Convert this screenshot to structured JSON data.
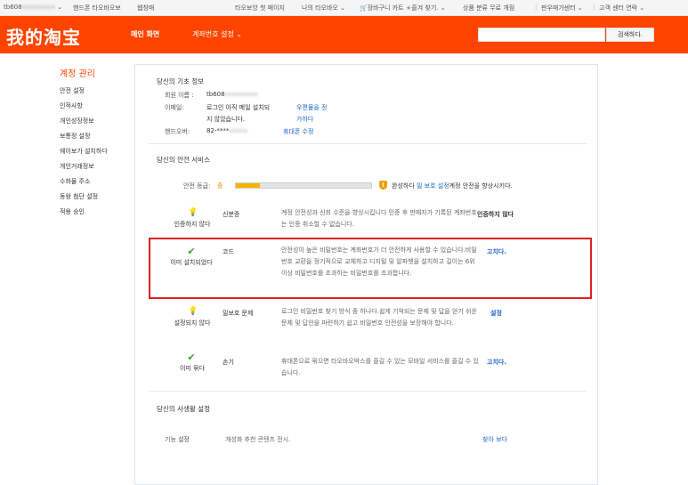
{
  "topbar": {
    "username": "tb608",
    "items": [
      "핸드폰 타오바오보",
      "웹창매",
      "타오보앙 첫 페이지",
      "나의 타오바오",
      "장바구니 카트",
      "즐겨 찾기.",
      "상품 분류 무료 개점",
      "판우매가센터",
      "고객 센터 연락"
    ]
  },
  "header": {
    "logo": "我的淘宝",
    "nav_home": "메인 화면",
    "nav_account": "계좌번호 설정",
    "search_button": "검색하다.",
    "search_placeholder": ""
  },
  "sidebar": {
    "title": "계정 관리",
    "items": [
      "안전 설정",
      "인적사항",
      "개인성장정보",
      "보통정 설정",
      "웨이보가 설치하다",
      "개인거래정보",
      "수화물 주소",
      "동왕 첨단 설정",
      "적용 승인"
    ]
  },
  "basic": {
    "title": "당신의 기초 정보",
    "member_label": "회원 이름 :",
    "member_value": "tb608",
    "email_label": "이메일:",
    "email_value_1": "로그인 아직 메일 설치되",
    "email_value_2": "지 않았습니다.",
    "email_link_1": "우편물을 정",
    "email_link_2": "가하다",
    "phone_label": "핸드오버:",
    "phone_value": "82-****",
    "phone_link": "휴대폰 수정"
  },
  "security": {
    "title": "당신의 안전 서비스",
    "level_label": "안전 등급:",
    "level_value": "중",
    "progress_fraction": 0.18,
    "complete_text": "완성하다",
    "complete_link": "밀 보호 설정",
    "complete_suffix": "계정 안전을 향상시키다.",
    "items": [
      {
        "status": "인증하지 않다",
        "name": "신분증",
        "desc": "계정 안전성과 신회 수준을 향상시킵니다 인증 후 판매자가 기록된 계좌번호는 인증 취소할 수 없습니다.",
        "action": "인증하지 않다"
      },
      {
        "status": "이미 설치되었다",
        "name": "코드",
        "desc": "안전성이 높은 비밀번호는 계좌번호가 더 안전하게 사용할 수 있습니다.비밀번호 교환을 정기적으로 교체하고 디지털 및 알파벳을 설치하고 길이는 6위 이상 비밀번호를 조과하는 비밀번호를 조과합니다.",
        "action": "고치다."
      },
      {
        "status": "설정되지 않다",
        "name": "밀보호 문제",
        "desc": "로그인 비밀번호 찾기 방식 중 하나다.쉽게 기억되는 문제 및 답을 얻기 쉬운 문제 및 답안을 마련하기 쉽고 비밀번호 안전성을 보장해야 합니다.",
        "action": "설정"
      },
      {
        "status": "이미 묶다",
        "name": "손기",
        "desc": "휴대폰으로 묶으면 타오바오박스를 즐길 수 있는 모바일 서비스를 즐길 수 있습니다.",
        "action": "고치다."
      }
    ]
  },
  "privacy": {
    "title": "당신의 사생활 설정",
    "feature_label": "기능 설정",
    "feature_desc": "개성화 추천 콘텐츠 전시.",
    "feature_link": "찾아 보다"
  },
  "colors": {
    "brand": "#ff4400",
    "link": "#1e64c8",
    "highlight": "#e02020",
    "progress": "#f6b400"
  }
}
